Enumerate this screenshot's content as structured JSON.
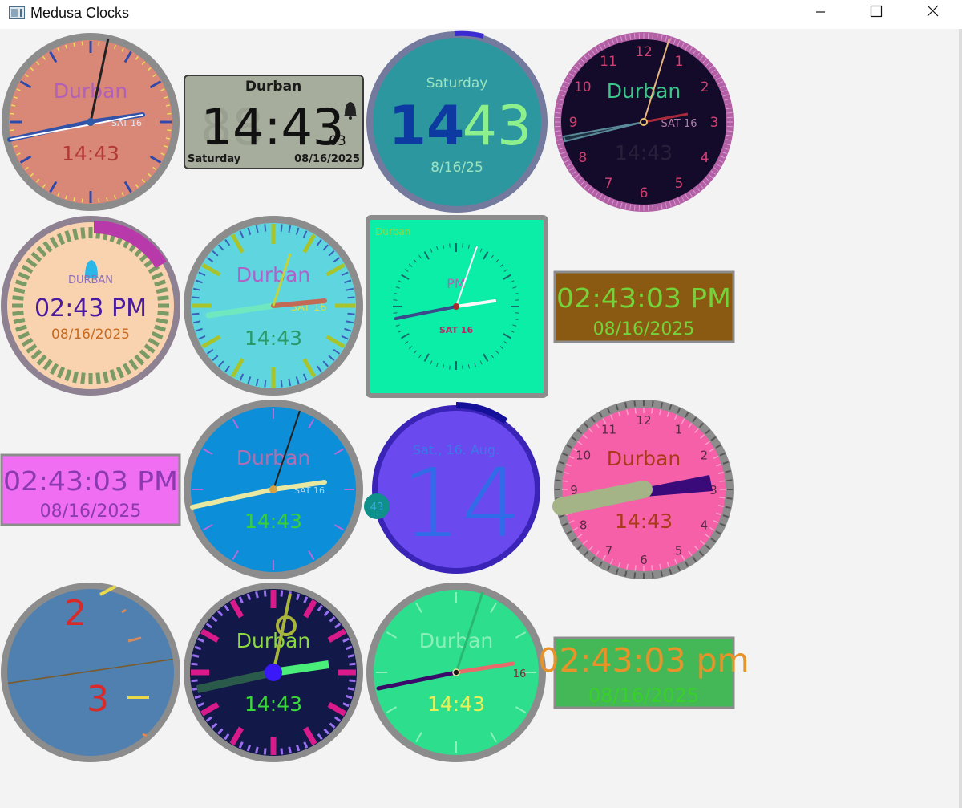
{
  "window": {
    "title": "Medusa Clocks"
  },
  "clocks": {
    "c1": {
      "city": "Durban",
      "date": "SAT 16",
      "time": "14:43"
    },
    "c2": {
      "city": "Durban",
      "time": "14:43",
      "seconds": "03",
      "day": "Saturday",
      "date": "08/16/2025"
    },
    "c3": {
      "day": "Saturday",
      "hour": "14",
      "minute": "43",
      "date": "8/16/25"
    },
    "c4": {
      "city": "Durban",
      "date": "SAT 16",
      "time": "14:43",
      "numbers": [
        "12",
        "1",
        "2",
        "3",
        "4",
        "5",
        "6",
        "7",
        "8",
        "9",
        "10",
        "11"
      ]
    },
    "c5": {
      "city": "DURBAN",
      "time": "02:43 PM",
      "date": "08/16/2025"
    },
    "c6": {
      "city": "Durban",
      "date": "SAT 16",
      "time": "14:43"
    },
    "c7": {
      "city": "Durban",
      "ampm": "PM",
      "date": "SAT 16"
    },
    "c8": {
      "time": "02:43:03 PM",
      "date": "08/16/2025"
    },
    "c9": {
      "time": "02:43:03 PM",
      "date": "08/16/2025"
    },
    "c10": {
      "city": "Durban",
      "date": "SAT 16",
      "time": "14:43"
    },
    "c11": {
      "date": "Sat., 16. Aug.",
      "hour": "14",
      "minute": "43"
    },
    "c12": {
      "city": "Durban",
      "time": "14:43",
      "numbers": [
        "12",
        "1",
        "2",
        "3",
        "4",
        "5",
        "6",
        "7",
        "8",
        "9",
        "10",
        "11"
      ]
    },
    "c13": {
      "hour_top": "2",
      "hour_bottom": "3"
    },
    "c14": {
      "city": "Durban",
      "time": "14:43"
    },
    "c15": {
      "city": "Durban",
      "date": "16",
      "time": "14:43"
    },
    "c16": {
      "time": "02:43:03 pm",
      "date": "08/16/2025"
    }
  }
}
